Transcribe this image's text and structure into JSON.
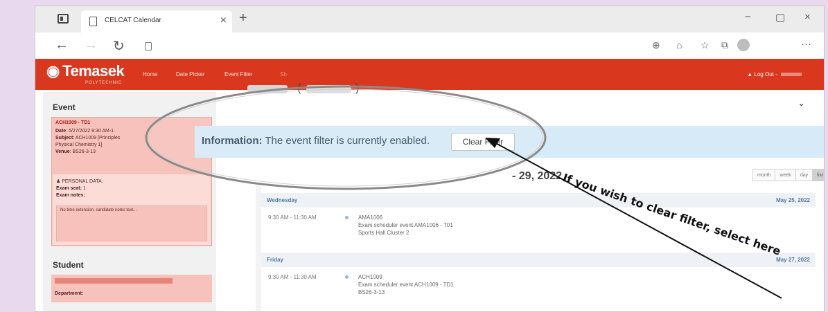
{
  "browser": {
    "tab_title": "CELCAT Calendar",
    "tab_close": "×",
    "new_tab": "+",
    "window_controls": {
      "minimize": "−",
      "maximize": "▢",
      "close": "×"
    },
    "nav": {
      "back": "←",
      "forward": "→",
      "refresh": "↻"
    },
    "toolbar_icons": {
      "zoom": "⊕",
      "favorites": "☆",
      "collections": "⧉",
      "more": "···"
    }
  },
  "app": {
    "logo": "Temasek",
    "logo_sub": "POLYTECHNIC",
    "nav": [
      "Home",
      "Date Picker",
      "Event Filter",
      "Sh"
    ],
    "logout": "Log Out -",
    "brand_color": "#d9381f"
  },
  "left": {
    "event_title": "Event",
    "event_code": "ACH1009 - TD1",
    "date_label": "Date",
    "date_value": ": 5/27/2022 9:30 AM-1",
    "subject_label": "Subject",
    "subject_value": ": ACH1009 [Principles",
    "subject_cont": "Physical Chemistry 1]",
    "venue_label": "Venue",
    "venue_value": ": BS26-3-13",
    "personal_label": "PERSONAL DATA:",
    "exam_seat_label": "Exam seat:",
    "exam_seat_value": "1",
    "exam_notes_label": "Exam notes:",
    "exam_notes_value": "No time extension, candidate notes text...",
    "student_title": "Student",
    "department_label": "Department:"
  },
  "main": {
    "expand_icon": "⌄",
    "info_label": "Information:",
    "info_text": " The event filter is currently enabled.",
    "clear_filter": "Clear Filter",
    "date_range": "- 29, 2022",
    "view_buttons": [
      "month",
      "week",
      "day",
      "list"
    ],
    "days": [
      {
        "name": "Wednesday",
        "date": "May 25, 2022",
        "time": "9:30 AM - 11:30 AM",
        "line1": "AMA1006",
        "line2": "Exam scheduler event AMA1006 - T01",
        "line3": "Sports Hall Cluster 2"
      },
      {
        "name": "Friday",
        "date": "May 27, 2022",
        "time": "9:30 AM - 11:30 AM",
        "line1": "ACH1009",
        "line2": "Exam scheduler event ACH1009 - TD1",
        "line3": "BS26-3-13"
      }
    ]
  },
  "annotation": {
    "text": "If you wish to clear filter, select here"
  }
}
